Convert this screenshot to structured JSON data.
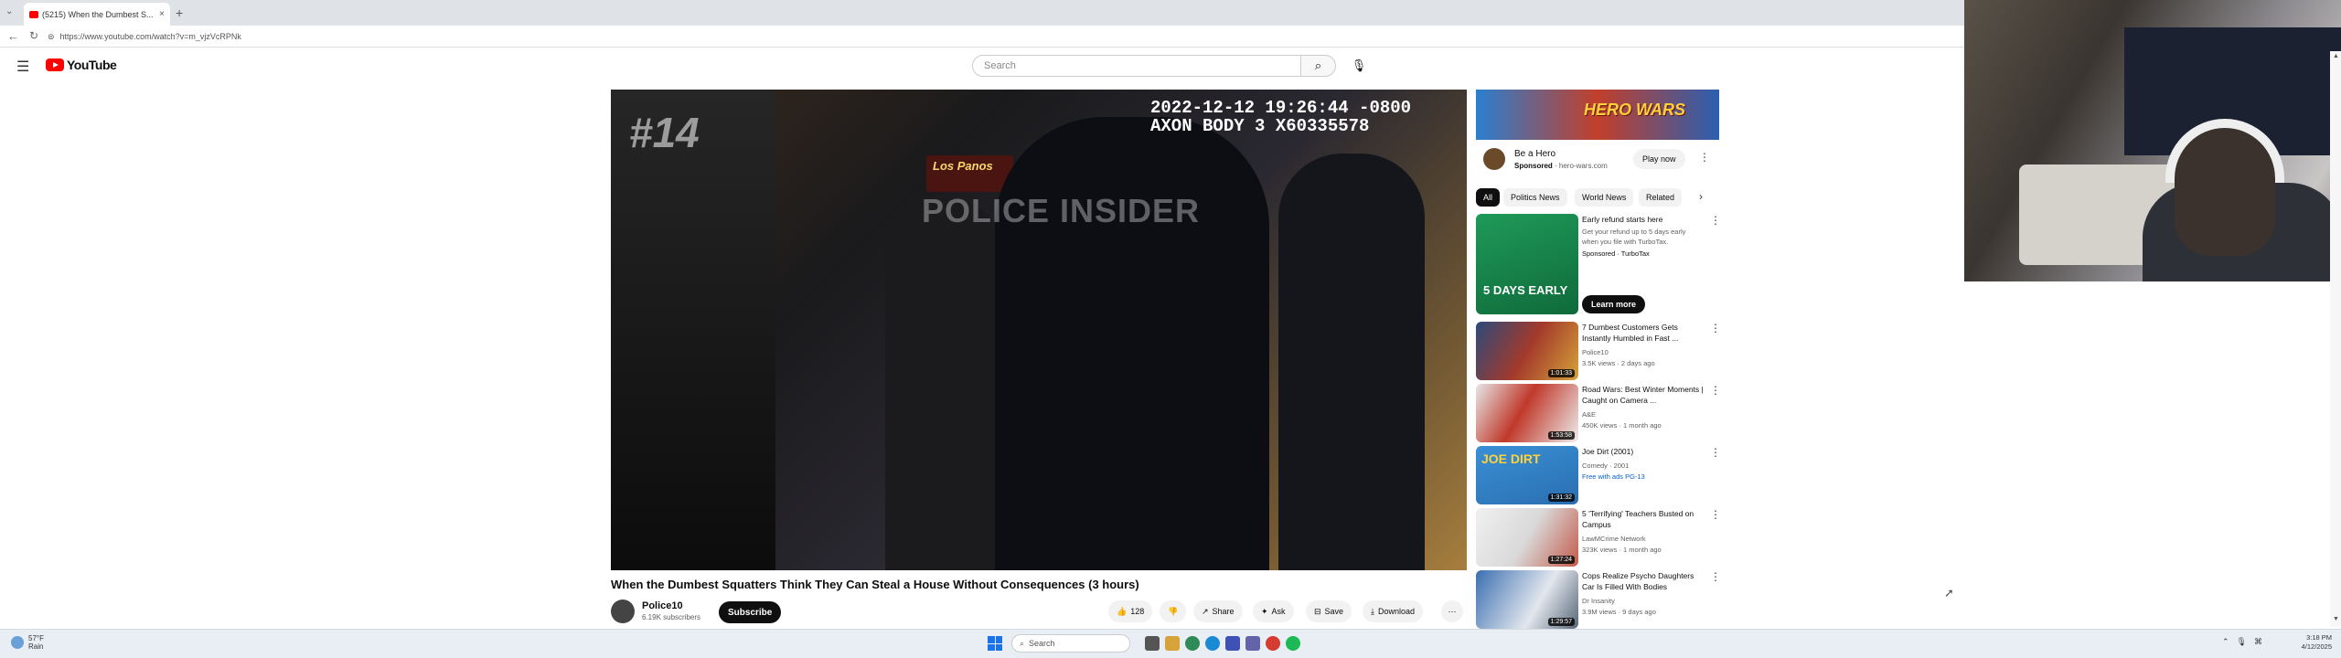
{
  "browser": {
    "tab_title": "(5215) When the Dumbest S...",
    "new_tab": "+",
    "url": "https://www.youtube.com/watch?v=m_vjzVcRPNk"
  },
  "youtube": {
    "logo": "YouTube",
    "search_placeholder": "Search"
  },
  "video": {
    "overlay_number": "#14",
    "overlay_timestamp": "2022-12-12 19:26:44 -0800\nAXON BODY 3 X60335578",
    "overlay_watermark": "POLICE INSIDER",
    "overlay_sign": "Los Panos",
    "title": "When the Dumbest Squatters Think They Can Steal a House Without Consequences (3 hours)",
    "channel": "Police10",
    "subscribers": "6.19K subscribers",
    "subscribe_label": "Subscribe",
    "likes": "128",
    "share_label": "Share",
    "ask_label": "Ask",
    "save_label": "Save",
    "download_label": "Download"
  },
  "ad": {
    "banner_text": "HERO WARS",
    "title": "Be a Hero",
    "sponsored": "Sponsored",
    "domain": "hero-wars.com",
    "cta": "Play now"
  },
  "chips": [
    "All",
    "Politics News",
    "World News",
    "Related"
  ],
  "recommendations": [
    {
      "title": "Early refund starts here",
      "line2": "Get your refund up to 5 days early when you file with TurboTax.",
      "meta1": "Sponsored · TurboTax",
      "thumb_text": "5 DAYS EARLY",
      "cta": "Learn more"
    },
    {
      "title": "7 Dumbest Customers Gets Instantly Humbled in Fast ...",
      "channel": "Police10",
      "meta": "3.5K views · 2 days ago",
      "duration": "1:01:33"
    },
    {
      "title": "Road Wars: Best Winter Moments | Caught on Camera ...",
      "channel": "A&E",
      "meta": "450K views · 1 month ago",
      "duration": "1:53:58"
    },
    {
      "title": "Joe Dirt (2001)",
      "channel": "Comedy · 2001",
      "meta": "Free with ads  PG-13",
      "duration": "1:31:32",
      "thumb_text": "JOE DIRT"
    },
    {
      "title": "5 'Terrifying' Teachers Busted on Campus",
      "channel": "LawMCrime Network",
      "meta": "323K views · 1 month ago",
      "duration": "1:27:24"
    },
    {
      "title": "Cops Realize Psycho Daughters Car Is Filled With Bodies",
      "channel": "Dr Insanity",
      "meta": "3.9M views · 9 days ago",
      "duration": "1:29:57"
    }
  ],
  "taskbar": {
    "weather_temp": "57°F",
    "weather_desc": "Rain",
    "search": "Search",
    "time": "3:18 PM",
    "date": "4/12/2025"
  },
  "colors": {
    "youtube_red": "#ff0000",
    "chip_active": "#0f0f0f",
    "taskbar": "#e9eef5"
  }
}
